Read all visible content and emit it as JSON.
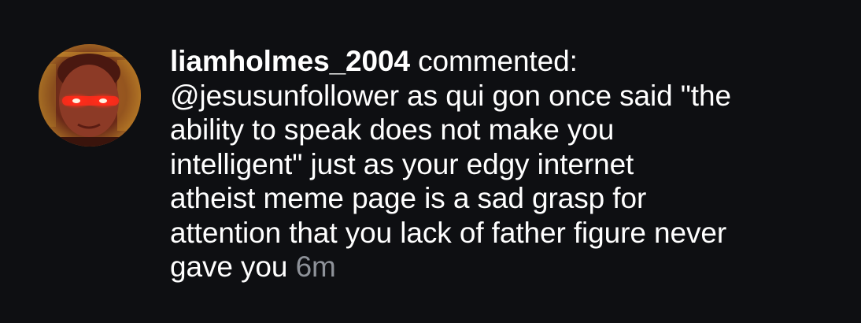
{
  "comment": {
    "username": "liamholmes_2004",
    "action": "commented:",
    "lines": [
      "@jesusunfollower as qui gon once said \"the",
      "ability to speak does not make you",
      "intelligent\" just as your edgy internet",
      "atheist meme page is a sad grasp for",
      "attention that you lack of father figure never",
      "gave you"
    ],
    "timestamp": "6m"
  },
  "colors": {
    "background": "#0e0f12",
    "text": "#ffffff",
    "timestamp": "#8e9299",
    "avatar_accent": "#ff2a1a"
  },
  "icons": {
    "avatar": "profile-photo-glowing-eyes"
  }
}
